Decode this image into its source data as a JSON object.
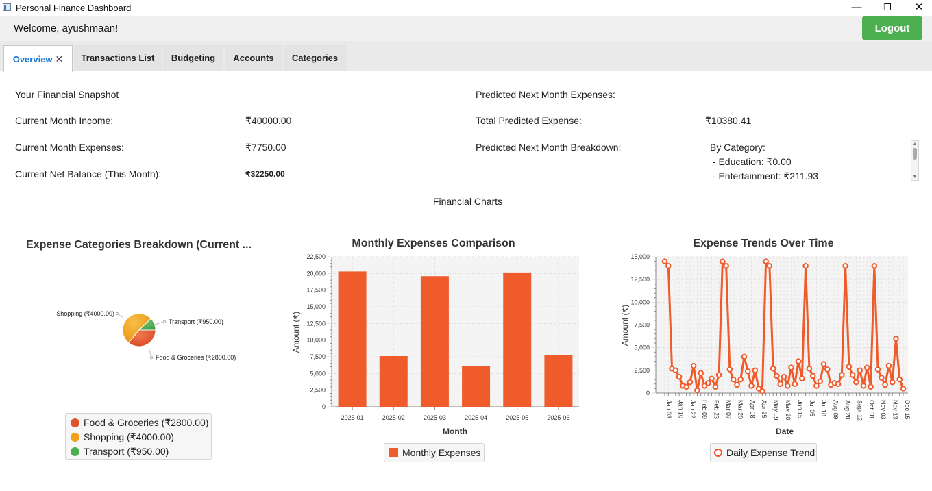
{
  "window": {
    "title": "Personal Finance Dashboard",
    "minimize": "—",
    "restore": "❐",
    "close": "✕"
  },
  "header": {
    "welcome": "Welcome, ayushmaan!",
    "logout_label": "Logout"
  },
  "tabs": [
    {
      "label": "Overview",
      "active": true,
      "close": "✕"
    },
    {
      "label": "Transactions List"
    },
    {
      "label": "Budgeting"
    },
    {
      "label": "Accounts"
    },
    {
      "label": "Categories"
    }
  ],
  "snapshot": {
    "heading": "Your Financial Snapshot",
    "income_label": "Current Month Income:",
    "income_value": "₹40000.00",
    "expenses_label": "Current Month Expenses:",
    "expenses_value": "₹7750.00",
    "net_label": "Current Net Balance (This Month):",
    "net_value": "₹32250.00"
  },
  "prediction": {
    "heading": "Predicted Next Month Expenses:",
    "total_label": "Total Predicted Expense:",
    "total_value": "₹10380.41",
    "breakdown_label": "Predicted Next Month Breakdown:",
    "breakdown_lines": [
      "By Category:",
      " - Education: ₹0.00",
      " - Entertainment: ₹211.93"
    ]
  },
  "charts_heading": "Financial Charts",
  "colors": {
    "orange": "#ef5b2a",
    "pie_orange": "#f0a21f",
    "pie_green": "#4caf50",
    "pie_red": "#e0522b",
    "logout_green": "#4caf50",
    "active_tab_blue": "#1e7bd6"
  },
  "chart_data": [
    {
      "type": "pie",
      "title": "Expense Categories Breakdown (Current ...",
      "slices": [
        {
          "label": "Food & Groceries (₹2800.00)",
          "value": 2800,
          "color": "#e0522b"
        },
        {
          "label": "Shopping (₹4000.00)",
          "value": 4000,
          "color": "#f0a21f"
        },
        {
          "label": "Transport (₹950.00)",
          "value": 950,
          "color": "#4caf50"
        }
      ],
      "legend_placement": "bottom"
    },
    {
      "type": "bar",
      "title": "Monthly Expenses Comparison",
      "xlabel": "Month",
      "ylabel": "Amount (₹)",
      "categories": [
        "2025-01",
        "2025-02",
        "2025-03",
        "2025-04",
        "2025-05",
        "2025-06"
      ],
      "series": [
        {
          "name": "Monthly Expenses",
          "values": [
            20300,
            7600,
            19600,
            6150,
            20150,
            7750
          ]
        }
      ],
      "ylim": [
        0,
        22500
      ],
      "yticks": [
        "0",
        "2,500",
        "5,000",
        "7,500",
        "10,000",
        "12,500",
        "15,000",
        "17,500",
        "20,000",
        "22,500"
      ],
      "grid": true,
      "legend_placement": "bottom"
    },
    {
      "type": "line",
      "title": "Expense Trends Over Time",
      "xlabel": "Date",
      "ylabel": "Amount (₹)",
      "xticks": [
        "Jan 03",
        "Jan 10",
        "Jan 22",
        "Feb 09",
        "Feb 23",
        "Mar 07",
        "Mar 20",
        "Apr 08",
        "Apr 25",
        "May 09",
        "May 20",
        "Jun 15",
        "Jul 05",
        "Jul 18",
        "Aug 09",
        "Aug 28",
        "Sept 12",
        "Oct 08",
        "Nov 03",
        "Nov 13",
        "Dec 15"
      ],
      "yticks": [
        "0",
        "2,500",
        "5,000",
        "7,500",
        "10,000",
        "12,500",
        "15,000"
      ],
      "ylim": [
        0,
        15000
      ],
      "series": [
        {
          "name": "Daily Expense Trend",
          "values": [
            14500,
            14000,
            2700,
            2500,
            1800,
            800,
            700,
            1200,
            3000,
            300,
            2200,
            800,
            1100,
            1600,
            700,
            2000,
            14500,
            14000,
            2600,
            1500,
            900,
            1500,
            4000,
            2400,
            800,
            2500,
            500,
            200,
            14500,
            14000,
            2700,
            1900,
            1000,
            1800,
            800,
            2800,
            1000,
            3500,
            1600,
            14000,
            2700,
            1900,
            800,
            1300,
            3200,
            2600,
            900,
            1100,
            1000,
            2000,
            14000,
            2900,
            2000,
            1200,
            2500,
            800,
            2800,
            700,
            14000,
            2600,
            1700,
            900,
            3000,
            1200,
            6000,
            1500,
            500
          ]
        }
      ],
      "grid": true,
      "legend_placement": "bottom"
    }
  ]
}
